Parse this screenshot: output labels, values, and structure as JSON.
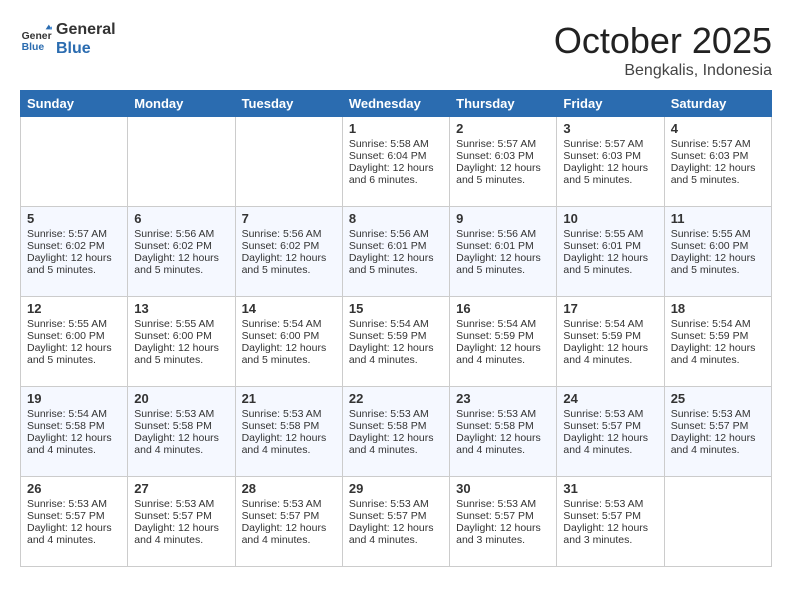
{
  "header": {
    "logo_line1": "General",
    "logo_line2": "Blue",
    "month": "October 2025",
    "location": "Bengkalis, Indonesia"
  },
  "weekdays": [
    "Sunday",
    "Monday",
    "Tuesday",
    "Wednesday",
    "Thursday",
    "Friday",
    "Saturday"
  ],
  "weeks": [
    [
      {
        "day": "",
        "empty": true
      },
      {
        "day": "",
        "empty": true
      },
      {
        "day": "",
        "empty": true
      },
      {
        "day": "1",
        "sunrise": "5:58 AM",
        "sunset": "6:04 PM",
        "daylight": "12 hours and 6 minutes."
      },
      {
        "day": "2",
        "sunrise": "5:57 AM",
        "sunset": "6:03 PM",
        "daylight": "12 hours and 5 minutes."
      },
      {
        "day": "3",
        "sunrise": "5:57 AM",
        "sunset": "6:03 PM",
        "daylight": "12 hours and 5 minutes."
      },
      {
        "day": "4",
        "sunrise": "5:57 AM",
        "sunset": "6:03 PM",
        "daylight": "12 hours and 5 minutes."
      }
    ],
    [
      {
        "day": "5",
        "sunrise": "5:57 AM",
        "sunset": "6:02 PM",
        "daylight": "12 hours and 5 minutes."
      },
      {
        "day": "6",
        "sunrise": "5:56 AM",
        "sunset": "6:02 PM",
        "daylight": "12 hours and 5 minutes."
      },
      {
        "day": "7",
        "sunrise": "5:56 AM",
        "sunset": "6:02 PM",
        "daylight": "12 hours and 5 minutes."
      },
      {
        "day": "8",
        "sunrise": "5:56 AM",
        "sunset": "6:01 PM",
        "daylight": "12 hours and 5 minutes."
      },
      {
        "day": "9",
        "sunrise": "5:56 AM",
        "sunset": "6:01 PM",
        "daylight": "12 hours and 5 minutes."
      },
      {
        "day": "10",
        "sunrise": "5:55 AM",
        "sunset": "6:01 PM",
        "daylight": "12 hours and 5 minutes."
      },
      {
        "day": "11",
        "sunrise": "5:55 AM",
        "sunset": "6:00 PM",
        "daylight": "12 hours and 5 minutes."
      }
    ],
    [
      {
        "day": "12",
        "sunrise": "5:55 AM",
        "sunset": "6:00 PM",
        "daylight": "12 hours and 5 minutes."
      },
      {
        "day": "13",
        "sunrise": "5:55 AM",
        "sunset": "6:00 PM",
        "daylight": "12 hours and 5 minutes."
      },
      {
        "day": "14",
        "sunrise": "5:54 AM",
        "sunset": "6:00 PM",
        "daylight": "12 hours and 5 minutes."
      },
      {
        "day": "15",
        "sunrise": "5:54 AM",
        "sunset": "5:59 PM",
        "daylight": "12 hours and 4 minutes."
      },
      {
        "day": "16",
        "sunrise": "5:54 AM",
        "sunset": "5:59 PM",
        "daylight": "12 hours and 4 minutes."
      },
      {
        "day": "17",
        "sunrise": "5:54 AM",
        "sunset": "5:59 PM",
        "daylight": "12 hours and 4 minutes."
      },
      {
        "day": "18",
        "sunrise": "5:54 AM",
        "sunset": "5:59 PM",
        "daylight": "12 hours and 4 minutes."
      }
    ],
    [
      {
        "day": "19",
        "sunrise": "5:54 AM",
        "sunset": "5:58 PM",
        "daylight": "12 hours and 4 minutes."
      },
      {
        "day": "20",
        "sunrise": "5:53 AM",
        "sunset": "5:58 PM",
        "daylight": "12 hours and 4 minutes."
      },
      {
        "day": "21",
        "sunrise": "5:53 AM",
        "sunset": "5:58 PM",
        "daylight": "12 hours and 4 minutes."
      },
      {
        "day": "22",
        "sunrise": "5:53 AM",
        "sunset": "5:58 PM",
        "daylight": "12 hours and 4 minutes."
      },
      {
        "day": "23",
        "sunrise": "5:53 AM",
        "sunset": "5:58 PM",
        "daylight": "12 hours and 4 minutes."
      },
      {
        "day": "24",
        "sunrise": "5:53 AM",
        "sunset": "5:57 PM",
        "daylight": "12 hours and 4 minutes."
      },
      {
        "day": "25",
        "sunrise": "5:53 AM",
        "sunset": "5:57 PM",
        "daylight": "12 hours and 4 minutes."
      }
    ],
    [
      {
        "day": "26",
        "sunrise": "5:53 AM",
        "sunset": "5:57 PM",
        "daylight": "12 hours and 4 minutes."
      },
      {
        "day": "27",
        "sunrise": "5:53 AM",
        "sunset": "5:57 PM",
        "daylight": "12 hours and 4 minutes."
      },
      {
        "day": "28",
        "sunrise": "5:53 AM",
        "sunset": "5:57 PM",
        "daylight": "12 hours and 4 minutes."
      },
      {
        "day": "29",
        "sunrise": "5:53 AM",
        "sunset": "5:57 PM",
        "daylight": "12 hours and 4 minutes."
      },
      {
        "day": "30",
        "sunrise": "5:53 AM",
        "sunset": "5:57 PM",
        "daylight": "12 hours and 3 minutes."
      },
      {
        "day": "31",
        "sunrise": "5:53 AM",
        "sunset": "5:57 PM",
        "daylight": "12 hours and 3 minutes."
      },
      {
        "day": "",
        "empty": true
      }
    ]
  ],
  "labels": {
    "sunrise": "Sunrise:",
    "sunset": "Sunset:",
    "daylight": "Daylight:"
  }
}
